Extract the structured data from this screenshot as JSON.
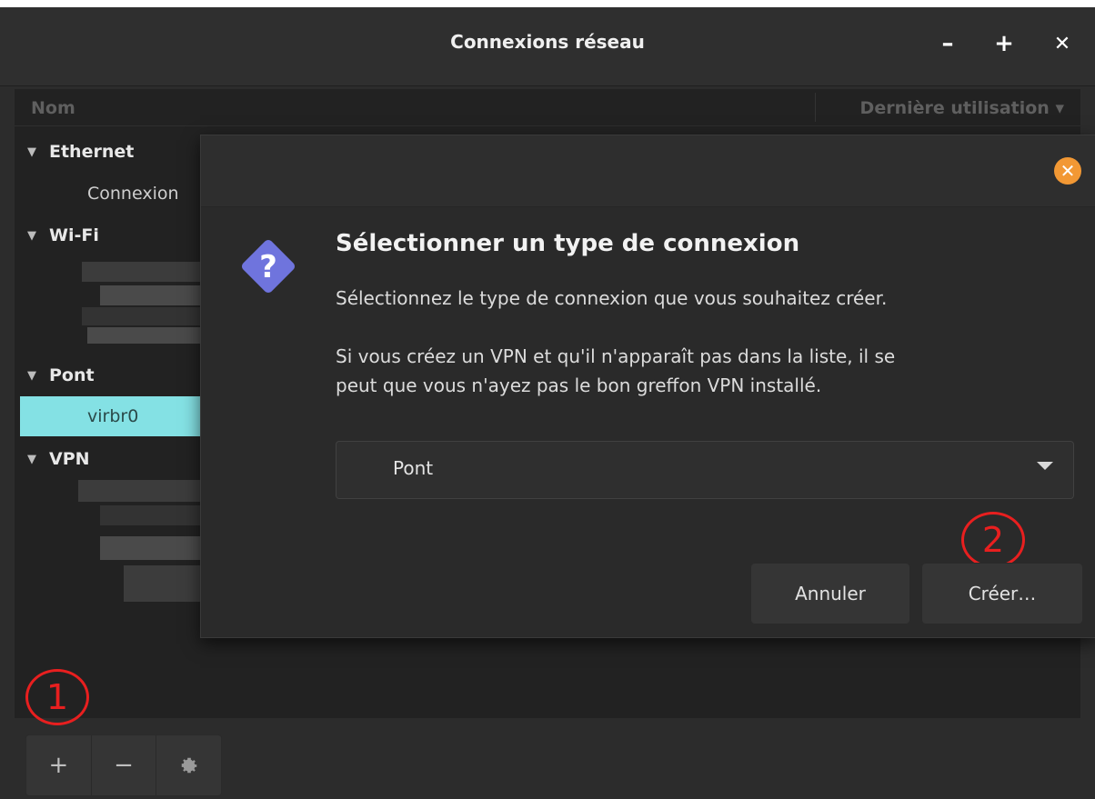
{
  "window": {
    "title": "Connexions réseau",
    "minimize": "–",
    "maximize": "+",
    "close": "✕"
  },
  "list": {
    "col_name": "Nom",
    "col_last_used": "Dernière utilisation",
    "sort_indicator": "▾",
    "groups": [
      {
        "label": "Ethernet",
        "entries": [
          "Connexion"
        ]
      },
      {
        "label": "Wi-Fi",
        "entries": []
      },
      {
        "label": "Pont",
        "entries": [
          "virbr0"
        ]
      },
      {
        "label": "VPN",
        "entries": []
      }
    ],
    "selected_entry": "virbr0"
  },
  "toolbar": {
    "add": "+",
    "remove": "−",
    "settings_icon": "gear-icon"
  },
  "dialog": {
    "close": "✕",
    "icon": "question-icon",
    "title": "Sélectionner un type de connexion",
    "subtitle": "Sélectionnez le type de connexion que vous souhaitez créer.",
    "note_line1": "Si vous créez un VPN et qu'il n'apparaît pas dans la liste, il se",
    "note_line2": "peut que vous n'ayez pas le bon greffon VPN installé.",
    "combo_value": "Pont",
    "cancel": "Annuler",
    "create": "Créer…"
  },
  "annotations": {
    "one": "1",
    "two": "2",
    "color": "#e81f1f"
  },
  "colors": {
    "selection": "#84e1e4",
    "dialog_close": "#f29834",
    "question_icon": "#6f74dd"
  }
}
